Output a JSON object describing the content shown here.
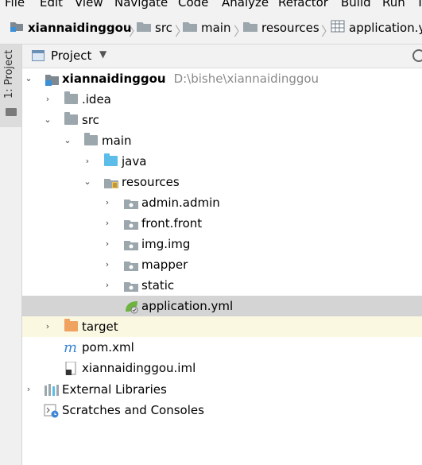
{
  "menu": [
    "File",
    "Edit",
    "View",
    "Navigate",
    "Code",
    "Analyze",
    "Refactor",
    "Build",
    "Run",
    "T"
  ],
  "breadcrumbs": [
    "xiannaidinggou",
    "src",
    "main",
    "resources",
    "application.yml"
  ],
  "side_tab": "1: Project",
  "panel": {
    "title": "Project"
  },
  "tree": [
    {
      "label": "xiannaidinggou",
      "path": "D:\\bishe\\xiannaidinggou"
    },
    {
      "label": ".idea"
    },
    {
      "label": "src"
    },
    {
      "label": "main"
    },
    {
      "label": "java"
    },
    {
      "label": "resources"
    },
    {
      "label": "admin.admin"
    },
    {
      "label": "front.front"
    },
    {
      "label": "img.img"
    },
    {
      "label": "mapper"
    },
    {
      "label": "static"
    },
    {
      "label": "application.yml"
    },
    {
      "label": "target"
    },
    {
      "label": "pom.xml"
    },
    {
      "label": "xiannaidinggou.iml"
    },
    {
      "label": "External Libraries"
    },
    {
      "label": "Scratches and Consoles"
    }
  ]
}
